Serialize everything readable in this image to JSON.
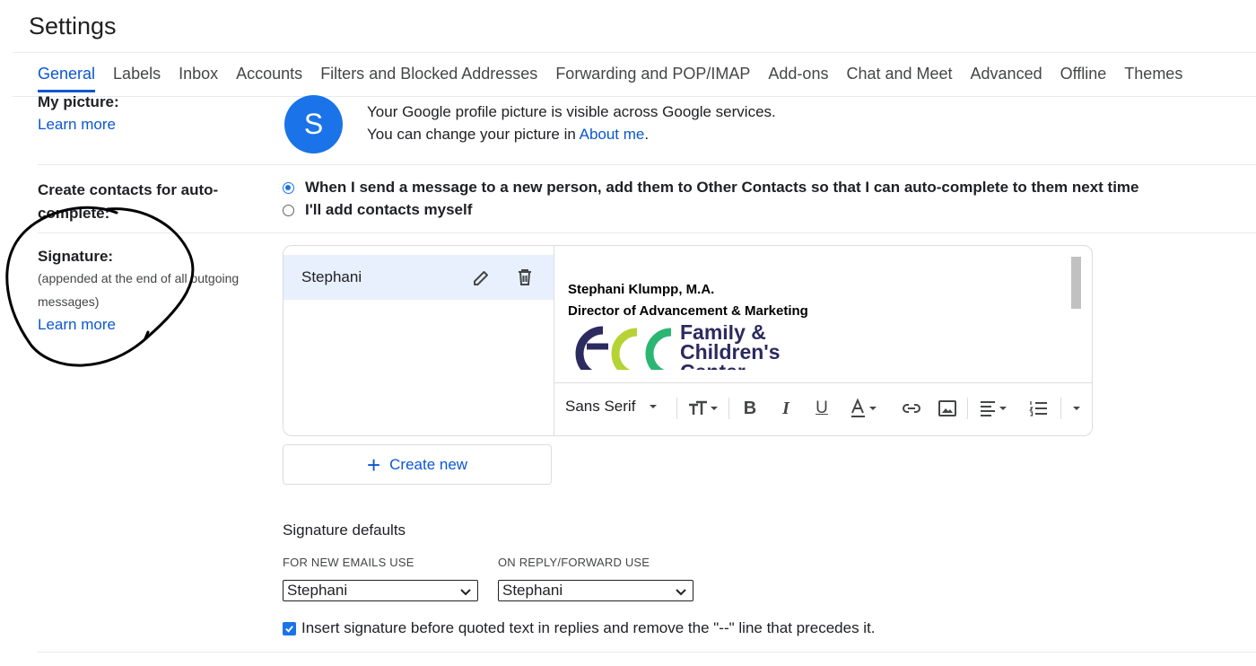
{
  "page": {
    "title": "Settings"
  },
  "tabs": [
    {
      "label": "General"
    },
    {
      "label": "Labels"
    },
    {
      "label": "Inbox"
    },
    {
      "label": "Accounts"
    },
    {
      "label": "Filters and Blocked Addresses"
    },
    {
      "label": "Forwarding and POP/IMAP"
    },
    {
      "label": "Add-ons"
    },
    {
      "label": "Chat and Meet"
    },
    {
      "label": "Advanced"
    },
    {
      "label": "Offline"
    },
    {
      "label": "Themes"
    }
  ],
  "my_picture": {
    "label": "My picture:",
    "learn_more": "Learn more",
    "avatar_letter": "S",
    "line1": "Your Google profile picture is visible across Google services.",
    "line2_prefix": "You can change your picture in ",
    "line2_link": "About me",
    "line2_suffix": "."
  },
  "contacts": {
    "label": "Create contacts for auto-complete:",
    "options": [
      {
        "label": "When I send a message to a new person, add them to Other Contacts so that I can auto-complete to them next time",
        "checked": true
      },
      {
        "label": "I'll add contacts myself",
        "checked": false
      }
    ]
  },
  "signature": {
    "label": "Signature:",
    "sublabel": "(appended at the end of all outgoing messages)",
    "learn_more": "Learn more",
    "items": [
      {
        "name": "Stephani"
      }
    ],
    "content": {
      "name_line": "Stephani Klumpp, M.A.",
      "title_line": "Director of Advancement & Marketing",
      "logo_text1": "Family &",
      "logo_text2": "Children's",
      "logo_text3": "Center"
    },
    "toolbar": {
      "font": "Sans Serif",
      "icons": [
        "text-size-icon",
        "bold-icon",
        "italic-icon",
        "underline-icon",
        "text-color-icon",
        "link-icon",
        "image-icon",
        "align-icon",
        "numbered-list-icon",
        "more-options-icon"
      ]
    },
    "create_new": "Create new"
  },
  "defaults": {
    "title": "Signature defaults",
    "new_emails_label": "FOR NEW EMAILS USE",
    "new_emails_value": "Stephani",
    "reply_label": "ON REPLY/FORWARD USE",
    "reply_value": "Stephani",
    "insert_checkbox": {
      "label": "Insert signature before quoted text in replies and remove the \"--\" line that precedes it.",
      "checked": true
    }
  },
  "colors": {
    "accent": "#0b57d0",
    "avatar": "#1a73e8",
    "selected_row": "#e8f0fe"
  }
}
